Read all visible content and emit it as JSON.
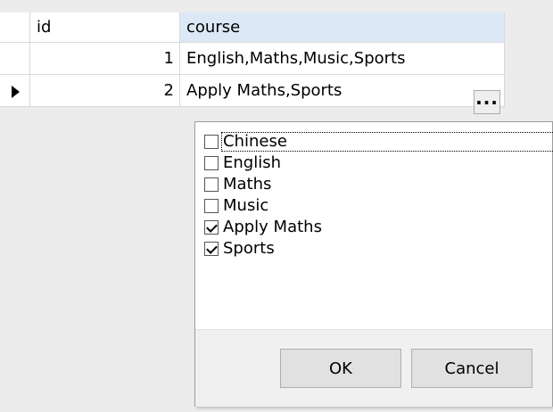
{
  "columns": {
    "id": "id",
    "course": "course"
  },
  "rows": [
    {
      "id": "1",
      "course": "English,Maths,Music,Sports"
    },
    {
      "id": "2",
      "course": "Apply Maths,Sports"
    }
  ],
  "row_indicator": "current-row-arrow",
  "ellipsis_button": "···",
  "options": [
    {
      "label": "Chinese",
      "checked": false
    },
    {
      "label": "English",
      "checked": false
    },
    {
      "label": "Maths",
      "checked": false
    },
    {
      "label": "Music",
      "checked": false
    },
    {
      "label": "Apply Maths",
      "checked": true
    },
    {
      "label": "Sports",
      "checked": true
    }
  ],
  "buttons": {
    "ok": "OK",
    "cancel": "Cancel"
  }
}
